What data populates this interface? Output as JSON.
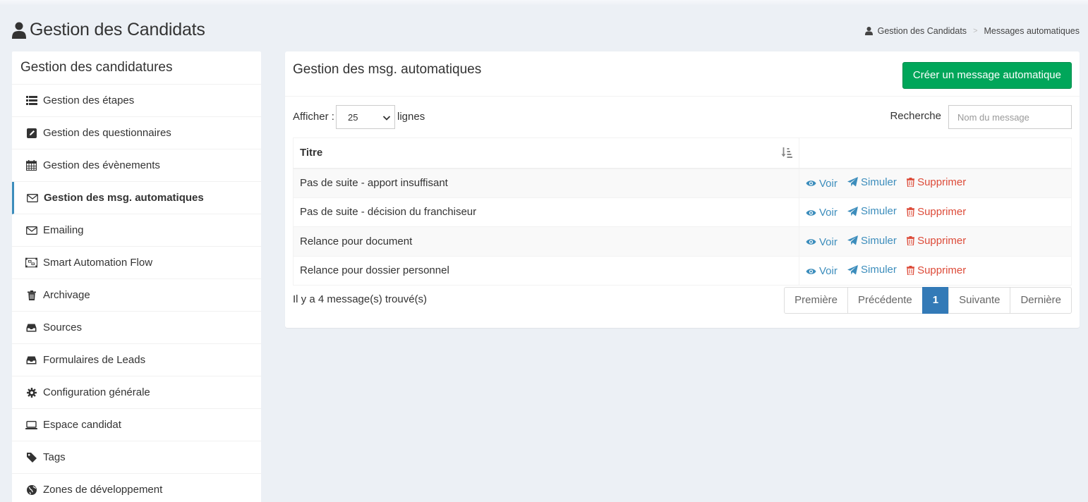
{
  "header": {
    "title": "Gestion des Candidats",
    "breadcrumb": [
      "Gestion des Candidats",
      "Messages automatiques"
    ],
    "breadcrumb_separator": ">"
  },
  "sidebar": {
    "heading": "Gestion des candidatures",
    "items": [
      {
        "label": "Gestion des étapes",
        "icon": "list-icon"
      },
      {
        "label": "Gestion des questionnaires",
        "icon": "edit-icon"
      },
      {
        "label": "Gestion des évènements",
        "icon": "calendar-icon"
      },
      {
        "label": "Gestion des msg. automatiques",
        "icon": "envelope-icon",
        "active": true
      },
      {
        "label": "Emailing",
        "icon": "envelope-icon"
      },
      {
        "label": "Smart Automation Flow",
        "icon": "flow-icon"
      },
      {
        "label": "Archivage",
        "icon": "trash-icon"
      },
      {
        "label": "Sources",
        "icon": "inbox-icon"
      },
      {
        "label": "Formulaires de Leads",
        "icon": "inbox-icon"
      },
      {
        "label": "Configuration générale",
        "icon": "gear-icon"
      },
      {
        "label": "Espace candidat",
        "icon": "laptop-icon"
      },
      {
        "label": "Tags",
        "icon": "tag-icon"
      },
      {
        "label": "Zones de développement",
        "icon": "globe-icon"
      }
    ]
  },
  "main": {
    "title": "Gestion des msg. automatiques",
    "create_button": "Créer un message automatique",
    "show_label": "Afficher :",
    "page_length": "25",
    "rows_label": "lignes",
    "search_label": "Recherche",
    "search_placeholder": "Nom du message",
    "table": {
      "columns": [
        "Titre",
        ""
      ],
      "rows": [
        "Pas de suite - apport insuffisant",
        "Pas de suite - décision du franchiseur",
        "Relance pour document",
        "Relance pour dossier personnel"
      ],
      "actions": {
        "view": "Voir",
        "simulate": "Simuler",
        "delete": "Supprimer"
      }
    },
    "info": "Il y a 4 message(s) trouvé(s)",
    "pagination": {
      "first": "Première",
      "previous": "Précédente",
      "current": "1",
      "next": "Suivante",
      "last": "Dernière"
    }
  },
  "colors": {
    "accent": "#3c8dbc",
    "success": "#00a65a",
    "danger": "#dd4b39",
    "page_active": "#337ab7",
    "background": "#ecf0f5"
  }
}
